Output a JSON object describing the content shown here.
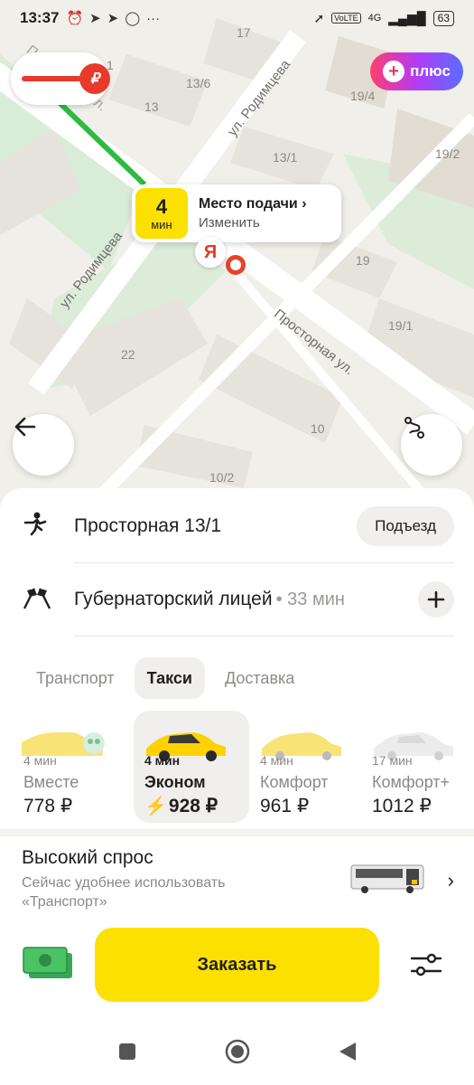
{
  "status_bar": {
    "time": "13:37",
    "icons": [
      "alarm-icon",
      "telegram-icon",
      "telegram-icon",
      "whatsapp-icon"
    ],
    "more": "···",
    "network": "4G",
    "volte": "VoLTE",
    "battery": "63"
  },
  "map": {
    "price_badge": "₽",
    "plus_label": "плюс",
    "pickup": {
      "eta_value": "4",
      "eta_unit": "мин",
      "title": "Место подачи",
      "action": "Изменить"
    },
    "pin_letter": "Я",
    "streets": [
      "ул. Родимцева",
      "ул. Родимцева",
      "Просторная ул.",
      "Просторная ул."
    ],
    "houses": [
      "17",
      "13/6",
      "13",
      "13/1",
      "19/4",
      "19/2",
      "19",
      "19/1",
      "22",
      "10",
      "10/2",
      "1"
    ]
  },
  "route": {
    "from": "Просторная 13/1",
    "entrance_button": "Подъезд",
    "to": "Губернаторский лицей",
    "to_time": "• 33 мин"
  },
  "modes": [
    {
      "label": "Транспорт",
      "active": false
    },
    {
      "label": "Такси",
      "active": true
    },
    {
      "label": "Доставка",
      "active": false
    }
  ],
  "tariffs": [
    {
      "time": "4 мин",
      "name": "Вместе",
      "price": "778 ₽",
      "car_color": "#f5d94a",
      "active": false
    },
    {
      "time": "4 мин",
      "name": "Эконом",
      "price": "928 ₽",
      "car_color": "#fcd200",
      "active": true,
      "surge": true
    },
    {
      "time": "4 мин",
      "name": "Комфорт",
      "price": "961 ₽",
      "car_color": "#f5d94a",
      "active": false
    },
    {
      "time": "17 мин",
      "name": "Комфорт+",
      "price": "1012 ₽",
      "car_color": "#e8e8e8",
      "active": false
    }
  ],
  "demand": {
    "title": "Высокий спрос",
    "description": "Сейчас удобнее использовать «Транспорт»"
  },
  "order": {
    "button_label": "Заказать",
    "payment_icon": "cash-icon",
    "settings_icon": "sliders-icon"
  },
  "colors": {
    "accent_yellow": "#fce000",
    "surge_red": "#e8432a",
    "route_green": "#2dbb3f"
  }
}
